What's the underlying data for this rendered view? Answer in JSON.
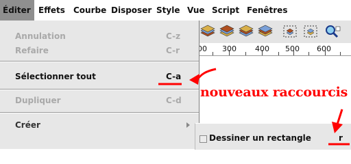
{
  "menubar": {
    "items": [
      "Éditer",
      "Effets",
      "Courbe",
      "Disposer",
      "Style",
      "Vue",
      "Script",
      "Fenêtres"
    ]
  },
  "edit_menu": {
    "items": [
      {
        "label": "Annulation",
        "shortcut": "C-z",
        "enabled": false
      },
      {
        "label": "Refaire",
        "shortcut": "C-r",
        "enabled": false
      },
      {
        "label": "Sélectionner tout",
        "shortcut": "C-a",
        "enabled": true
      },
      {
        "label": "Dupliquer",
        "shortcut": "C-d",
        "enabled": false
      },
      {
        "label": "Créer",
        "shortcut": "",
        "enabled": true,
        "submenu": true
      }
    ]
  },
  "toolbar": {
    "icons": [
      "layer-stack-icon",
      "layer-stack-icon",
      "layer-stack-icon",
      "layer-stack-icon",
      "dotted-selection-icon",
      "dotted-selection-icon",
      "zoom-icon"
    ]
  },
  "ruler": {
    "labels": [
      "00",
      "300",
      "400",
      "500",
      "600"
    ]
  },
  "submenu": {
    "item_label": "Dessiner un rectangle",
    "item_shortcut": "r"
  },
  "annotation": {
    "text": "nouveaux raccourcis",
    "color": "#ff0000"
  }
}
